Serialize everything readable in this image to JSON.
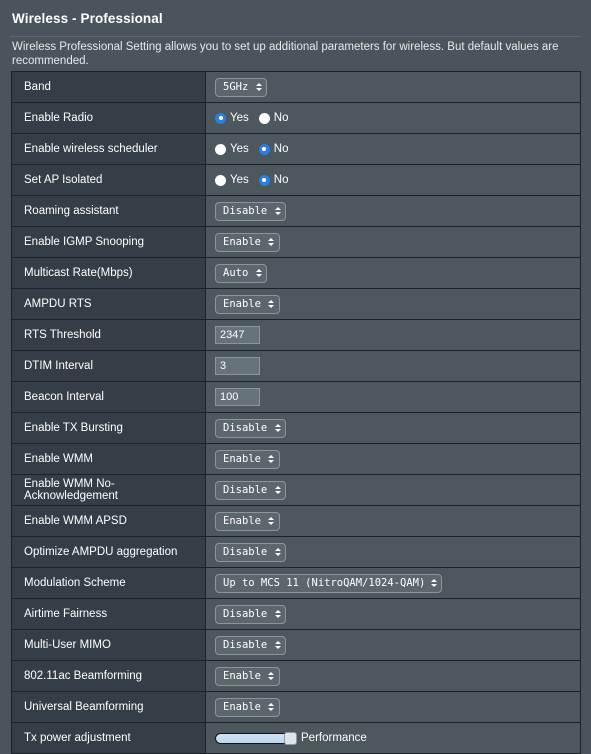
{
  "header": {
    "title": "Wireless - Professional",
    "description": "Wireless Professional Setting allows you to set up additional parameters for wireless. But default values are recommended."
  },
  "radio_labels": {
    "yes": "Yes",
    "no": "No"
  },
  "rows": [
    {
      "label": "Band",
      "type": "select",
      "value": "5GHz"
    },
    {
      "label": "Enable Radio",
      "type": "radio",
      "value": "Yes"
    },
    {
      "label": "Enable wireless scheduler",
      "type": "radio",
      "value": "No"
    },
    {
      "label": "Set AP Isolated",
      "type": "radio",
      "value": "No"
    },
    {
      "label": "Roaming assistant",
      "type": "select",
      "value": "Disable"
    },
    {
      "label": "Enable IGMP Snooping",
      "type": "select",
      "value": "Enable"
    },
    {
      "label": "Multicast Rate(Mbps)",
      "type": "select",
      "value": "Auto"
    },
    {
      "label": "AMPDU RTS",
      "type": "select",
      "value": "Enable"
    },
    {
      "label": "RTS Threshold",
      "type": "text",
      "value": "2347"
    },
    {
      "label": "DTIM Interval",
      "type": "text",
      "value": "3"
    },
    {
      "label": "Beacon Interval",
      "type": "text",
      "value": "100"
    },
    {
      "label": "Enable TX Bursting",
      "type": "select",
      "value": "Disable"
    },
    {
      "label": "Enable WMM",
      "type": "select",
      "value": "Enable"
    },
    {
      "label": "Enable WMM No-Acknowledgement",
      "type": "select",
      "value": "Disable"
    },
    {
      "label": "Enable WMM APSD",
      "type": "select",
      "value": "Enable"
    },
    {
      "label": "Optimize AMPDU aggregation",
      "type": "select",
      "value": "Disable"
    },
    {
      "label": "Modulation Scheme",
      "type": "select",
      "value": "Up to MCS 11 (NitroQAM/1024-QAM)"
    },
    {
      "label": "Airtime Fairness",
      "type": "select",
      "value": "Disable"
    },
    {
      "label": "Multi-User MIMO",
      "type": "select",
      "value": "Disable"
    },
    {
      "label": "802.11ac Beamforming",
      "type": "select",
      "value": "Enable"
    },
    {
      "label": "Universal Beamforming",
      "type": "select",
      "value": "Enable"
    },
    {
      "label": "Tx power adjustment",
      "type": "slider",
      "value": "Performance",
      "percent": 100
    }
  ],
  "colors": {
    "page_background": "#4b545c",
    "label_cell": "#353e47",
    "value_cell": "#4d575e",
    "border": "#1d2226",
    "radio_accent": "#2a7fe0",
    "slider_track": "#cfe2f3"
  }
}
